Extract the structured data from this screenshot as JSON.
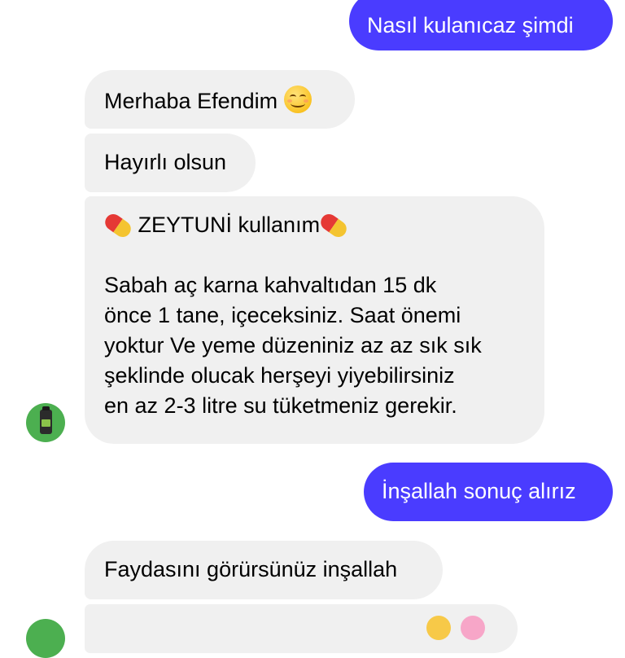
{
  "messages": [
    {
      "id": "b1",
      "direction": "sent",
      "text": "Nasıl kulanıcaz şimdi"
    },
    {
      "id": "b2",
      "direction": "received",
      "text": "Merhaba Efendim",
      "emoji": "smiling-face-icon"
    },
    {
      "id": "b3",
      "direction": "received",
      "text": "Hayırlı olsun"
    },
    {
      "id": "b4",
      "direction": "received",
      "title": "ZEYTUNİ kullanım",
      "title_icon": "pill-icon",
      "lines": [
        "Sabah aç karna kahvaltıdan 15 dk",
        "önce 1 tane, içeceksiniz. Saat önemi",
        "yoktur Ve yeme düzeniniz az az sık sık",
        "şeklinde olucak herşeyi yiyebilirsiniz",
        "en az 2-3 litre su tüketmeniz gerekir."
      ]
    },
    {
      "id": "b5",
      "direction": "sent",
      "text": "İnşallah sonuç alırız"
    },
    {
      "id": "b6",
      "direction": "received",
      "text": "Faydasını görürsünüz inşallah"
    }
  ],
  "colors": {
    "sent_bubble": "#4a3cff",
    "received_bubble": "#f0f0f0",
    "avatar": "#4caf50"
  }
}
